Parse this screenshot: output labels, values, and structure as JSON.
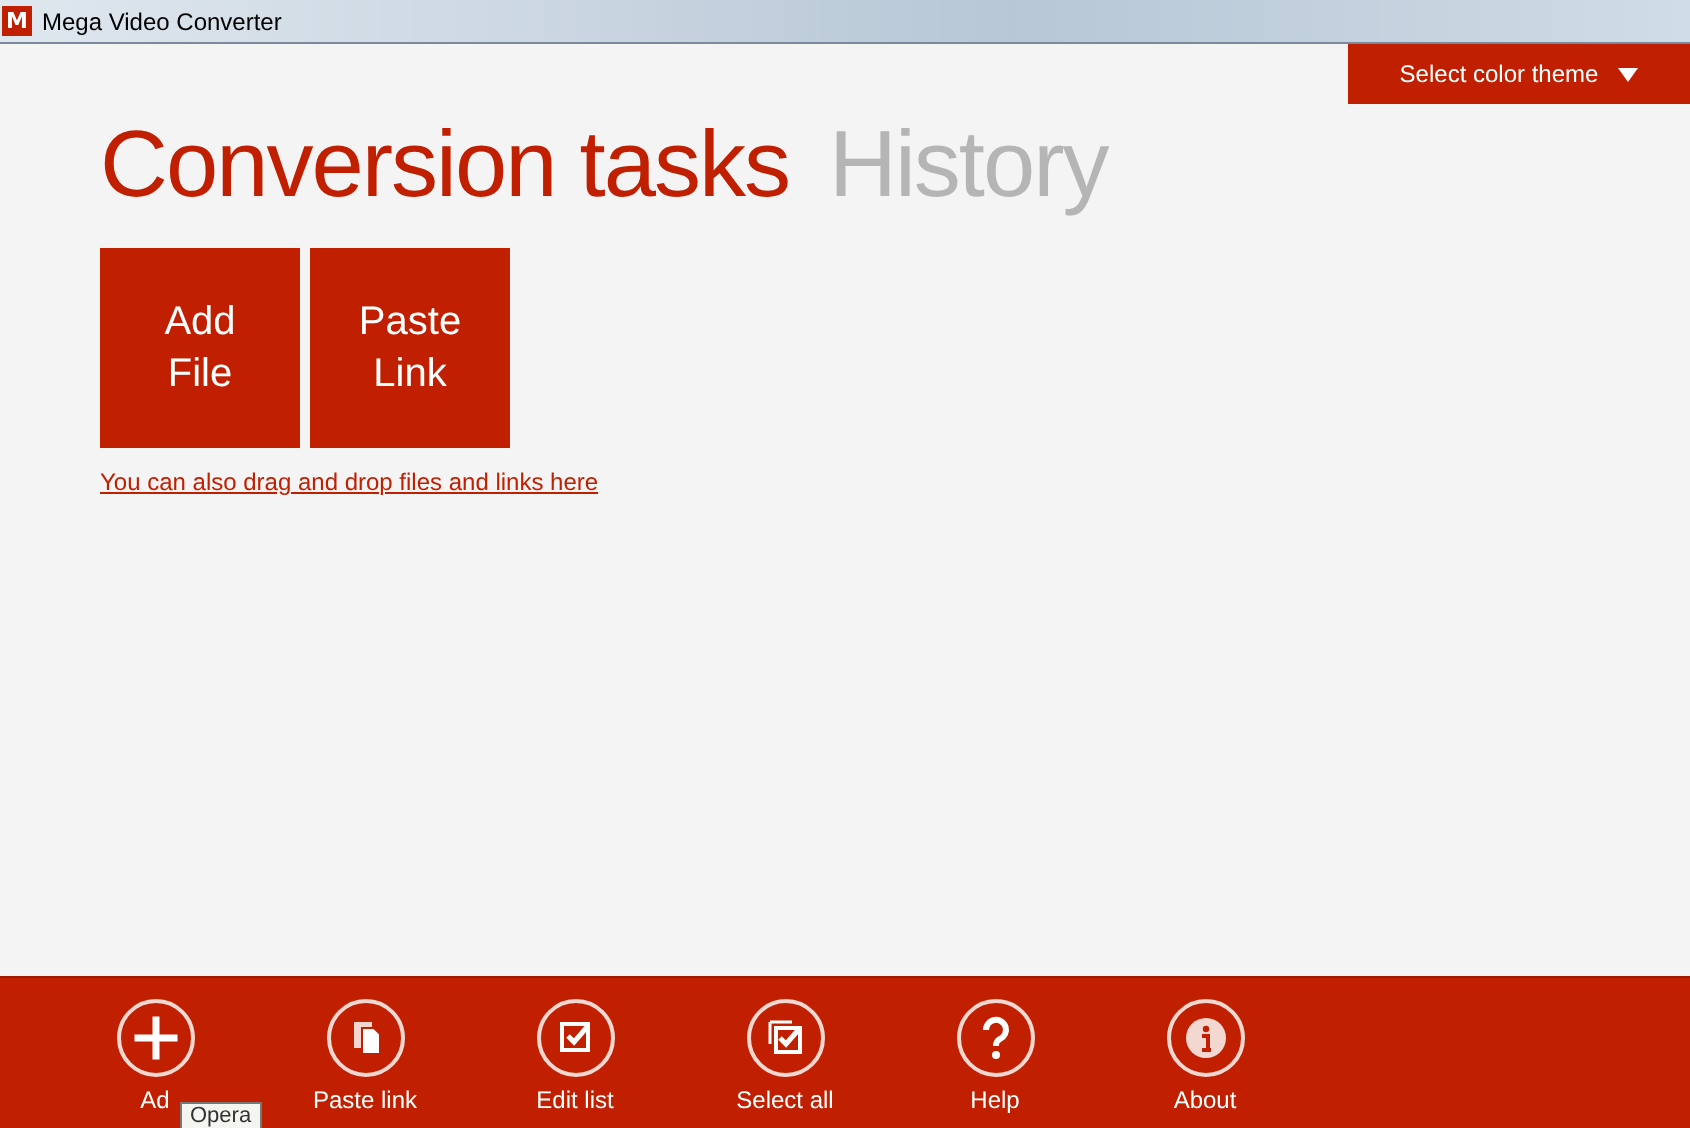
{
  "window": {
    "title": "Mega Video Converter",
    "logo": "M"
  },
  "theme_button": {
    "label": "Select color theme"
  },
  "tabs": [
    {
      "label": "Conversion tasks",
      "selected": true
    },
    {
      "label": "History",
      "selected": false
    }
  ],
  "tiles": [
    {
      "label": "Add File"
    },
    {
      "label": "Paste Link"
    }
  ],
  "drop_hint": "You can also drag and drop files and links here",
  "toolbar": [
    {
      "kind": "add",
      "label": "Ad"
    },
    {
      "kind": "paste",
      "label": "Paste link"
    },
    {
      "kind": "edit",
      "label": "Edit list"
    },
    {
      "kind": "selectall",
      "label": "Select all"
    },
    {
      "kind": "help",
      "label": "Help"
    },
    {
      "kind": "about",
      "label": "About"
    }
  ],
  "tooltip": "Opera"
}
